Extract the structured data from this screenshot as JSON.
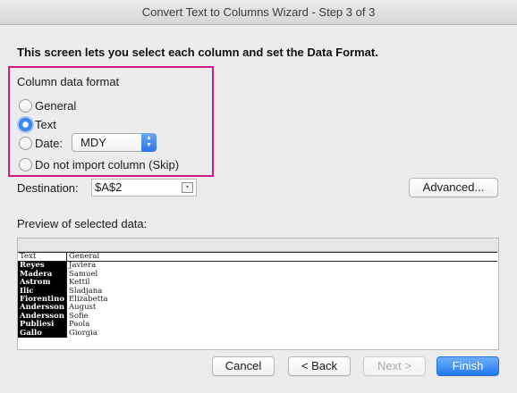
{
  "window": {
    "title": "Convert Text to Columns Wizard - Step 3 of 3"
  },
  "instruction": "This screen lets you select each column and set the Data Format.",
  "format": {
    "group_label": "Column data format",
    "options": [
      {
        "label": "General",
        "checked": false
      },
      {
        "label": "Text",
        "checked": true
      },
      {
        "label": "Date:",
        "checked": false
      },
      {
        "label": "Do not import column (Skip)",
        "checked": false
      }
    ],
    "date_select_value": "MDY"
  },
  "destination": {
    "label": "Destination:",
    "value": "$A$2"
  },
  "advanced_button": "Advanced...",
  "preview": {
    "label": "Preview of selected data:",
    "headers": [
      "Text",
      "General"
    ],
    "rows": [
      [
        "Reyes",
        "Javiera"
      ],
      [
        "Madera",
        "Samuel"
      ],
      [
        "Astrom",
        "Kettil"
      ],
      [
        "Ilic",
        "Sladjana"
      ],
      [
        "Fiorentino",
        "Elizabetta"
      ],
      [
        "Andersson",
        "August"
      ],
      [
        "Andersson",
        "Sofie"
      ],
      [
        "Publiesi",
        "Paola"
      ],
      [
        "Gallo",
        "Giorgia"
      ]
    ]
  },
  "buttons": {
    "cancel": "Cancel",
    "back": "< Back",
    "next": "Next >",
    "finish": "Finish"
  },
  "colors": {
    "highlight_box": "#d6197f",
    "accent": "#2a74e6"
  }
}
